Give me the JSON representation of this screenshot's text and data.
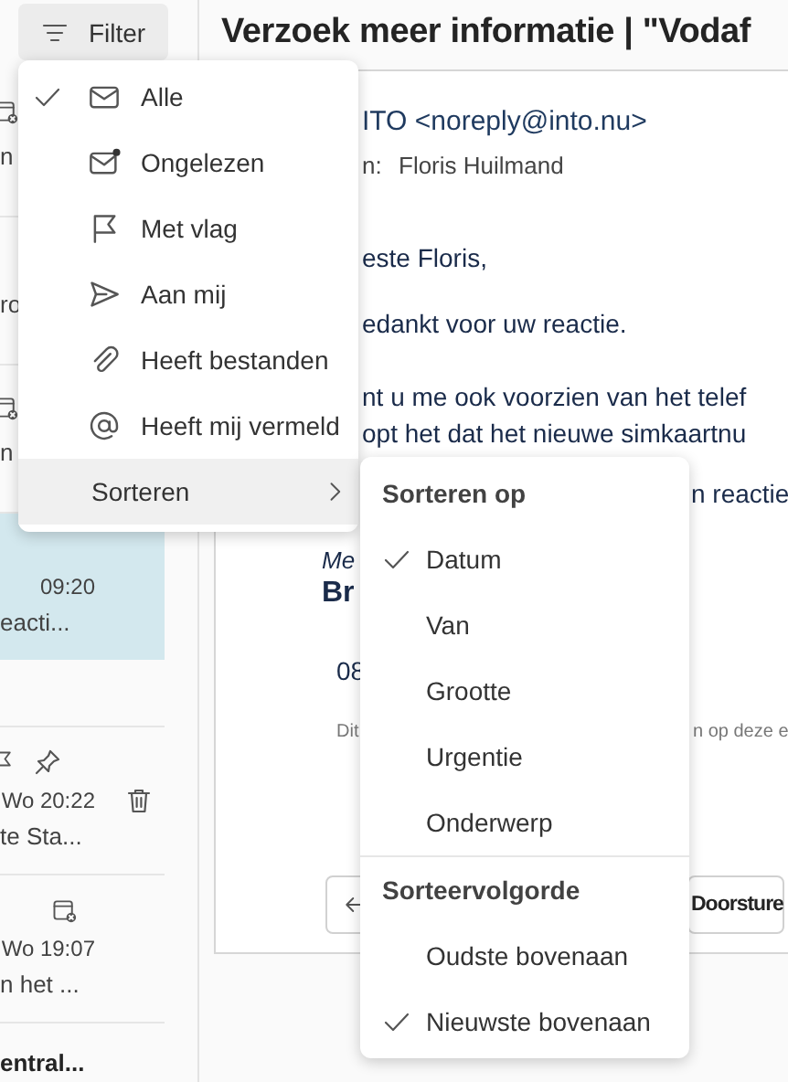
{
  "filter_button": {
    "label": "Filter"
  },
  "message_list": [
    {
      "kind": "meeting",
      "preview": "n",
      "selected": false,
      "unread": false
    },
    {
      "kind": "plain",
      "preview": "ro",
      "selected": false,
      "unread": false
    },
    {
      "kind": "meeting",
      "preview": "n",
      "selected": false,
      "unread": false
    },
    {
      "kind": "plain",
      "time": "09:20",
      "preview": "eacti...",
      "selected": true,
      "unread": false
    },
    {
      "kind": "hover",
      "time": "Wo 20:22",
      "preview": "te Sta...",
      "selected": false,
      "unread": false
    },
    {
      "kind": "meeting",
      "time": "Wo 19:07",
      "preview": "n het ...",
      "selected": false,
      "unread": false
    },
    {
      "kind": "plain",
      "preview": "entral...",
      "selected": false,
      "unread": true
    }
  ],
  "reader": {
    "title": "Verzoek meer informatie | \"Vodaf",
    "sender": "ITO <noreply@into.nu>",
    "to_label": "n:",
    "to_name": "Floris Huilmand",
    "body": [
      "este Floris,",
      "edankt voor uw reactie.",
      "nt u me ook voorzien van het telef",
      "opt het dat het nieuwe simkaartnu"
    ],
    "body_right": "n reactie",
    "quote_label": "Me",
    "quote_name": "Br",
    "quote_time": "08",
    "disclaimer_left": "Dit",
    "disclaimer_right": "n op deze e",
    "forward_button": "Doorsture"
  },
  "filter_menu": {
    "items": [
      {
        "label": "Alle",
        "selected": true
      },
      {
        "label": "Ongelezen",
        "selected": false
      },
      {
        "label": "Met vlag",
        "selected": false
      },
      {
        "label": "Aan mij",
        "selected": false
      },
      {
        "label": "Heeft bestanden",
        "selected": false
      },
      {
        "label": "Heeft mij vermeld",
        "selected": false
      }
    ],
    "submenu": {
      "label": "Sorteren",
      "highlighted": true
    }
  },
  "sort_menu": {
    "sections": [
      {
        "heading": "Sorteren op",
        "items": [
          {
            "label": "Datum",
            "selected": true
          },
          {
            "label": "Van",
            "selected": false
          },
          {
            "label": "Grootte",
            "selected": false
          },
          {
            "label": "Urgentie",
            "selected": false
          },
          {
            "label": "Onderwerp",
            "selected": false
          }
        ]
      },
      {
        "heading": "Sorteervolgorde",
        "items": [
          {
            "label": "Oudste bovenaan",
            "selected": false
          },
          {
            "label": "Nieuwste bovenaan",
            "selected": true
          }
        ]
      }
    ]
  }
}
